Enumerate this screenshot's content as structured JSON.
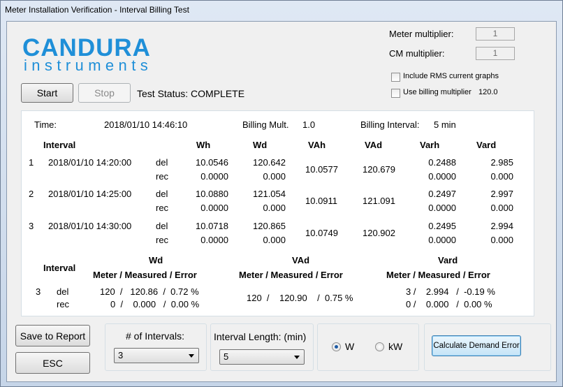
{
  "window": {
    "title": "Meter Installation Verification - Interval Billing Test"
  },
  "logo": {
    "line1": "CANDURA",
    "line2": "instruments"
  },
  "controls": {
    "start_label": "Start",
    "stop_label": "Stop",
    "status": "Test Status: COMPLETE",
    "meter_multiplier_label": "Meter multiplier:",
    "meter_multiplier_value": "1",
    "cm_multiplier_label": "CM multiplier:",
    "cm_multiplier_value": "1",
    "include_rms_label": "Include RMS current graphs",
    "use_billing_label": "Use billing multiplier",
    "billing_multiplier_value": "120.0"
  },
  "summary": {
    "time_label": "Time:",
    "time_value": "2018/01/10 14:46:10",
    "billing_mult_label": "Billing Mult.",
    "billing_mult_value": "1.0",
    "billing_interval_label": "Billing Interval:",
    "billing_interval_value": "5 min"
  },
  "table": {
    "headers": [
      "Interval",
      "Wh",
      "Wd",
      "VAh",
      "VAd",
      "Varh",
      "Vard"
    ],
    "rows": [
      {
        "num": "1",
        "time": "2018/01/10 14:20:00",
        "del": "del",
        "rec": "rec",
        "wh_del": "10.0546",
        "wh_rec": "0.0000",
        "wd_del": "120.642",
        "wd_rec": "0.000",
        "vah": "10.0577",
        "vad": "120.679",
        "varh_del": "0.2488",
        "varh_rec": "0.0000",
        "vard_del": "2.985",
        "vard_rec": "0.000"
      },
      {
        "num": "2",
        "time": "2018/01/10 14:25:00",
        "del": "del",
        "rec": "rec",
        "wh_del": "10.0880",
        "wh_rec": "0.0000",
        "wd_del": "121.054",
        "wd_rec": "0.000",
        "vah": "10.0911",
        "vad": "121.091",
        "varh_del": "0.2497",
        "varh_rec": "0.0000",
        "vard_del": "2.997",
        "vard_rec": "0.000"
      },
      {
        "num": "3",
        "time": "2018/01/10 14:30:00",
        "del": "del",
        "rec": "rec",
        "wh_del": "10.0718",
        "wh_rec": "0.0000",
        "wd_del": "120.865",
        "wd_rec": "0.000",
        "vah": "10.0749",
        "vad": "120.902",
        "varh_del": "0.2495",
        "varh_rec": "0.0000",
        "vard_del": "2.994",
        "vard_rec": "0.000"
      }
    ]
  },
  "demand": {
    "interval_header": "Interval",
    "wd_header": "Wd",
    "vad_header": "VAd",
    "vard_header": "Vard",
    "sub_header": "Meter / Measured / Error",
    "interval": "3",
    "del_label": "del",
    "rec_label": "rec",
    "wd_del": "120  /   120.86  /  0.72 %",
    "wd_rec": "0  /    0.000   /  0.00 %",
    "vad": "120  /    120.90    /  0.75 %",
    "vard_del": "3 /    2.994   /  -0.19 %",
    "vard_rec": "0 /    0.000   /  0.00 %"
  },
  "bottom": {
    "save_label": "Save to Report",
    "esc_label": "ESC",
    "num_intervals_label": "# of Intervals:",
    "num_intervals_value": "3",
    "interval_length_label": "Interval Length: (min)",
    "interval_length_value": "5",
    "unit_w": "W",
    "unit_kw": "kW",
    "selected_unit": "W",
    "calc_label": "Calculate Demand Error"
  }
}
